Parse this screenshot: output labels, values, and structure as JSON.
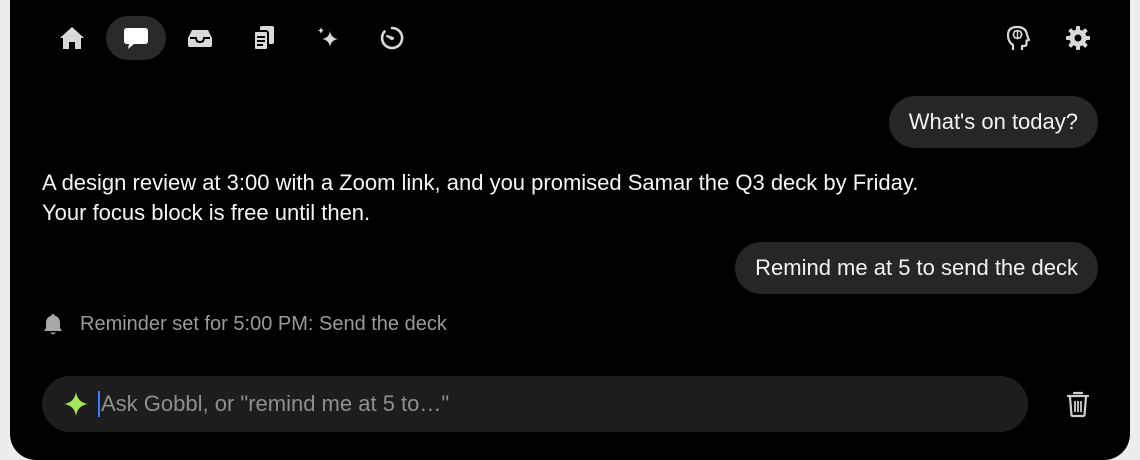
{
  "nav": {
    "tabs": [
      {
        "icon": "home-icon",
        "active": false
      },
      {
        "icon": "chat-bubble-icon",
        "active": true
      },
      {
        "icon": "inbox-icon",
        "active": false
      },
      {
        "icon": "documents-icon",
        "active": false
      },
      {
        "icon": "sparkles-icon",
        "active": false
      },
      {
        "icon": "timer-icon",
        "active": false
      }
    ],
    "right_icons": [
      "brain-head-icon",
      "gear-icon"
    ]
  },
  "conversation": {
    "user_message_1": "What's on today?",
    "assistant_message_1_line_1": "A design review at 3:00 with a Zoom link, and you promised Samar the Q3 deck by Friday.",
    "assistant_message_1_line_2": "Your focus block is free until then.",
    "user_message_2": "Remind me at 5 to send the deck",
    "reminder_status": "Reminder set for 5:00 PM: Send the deck"
  },
  "composer": {
    "placeholder": "Ask Gobbl, or \"remind me at 5 to…\"",
    "value": ""
  },
  "colors": {
    "background": "#000000",
    "bubble": "#262626",
    "input_bar": "#1d1d1d",
    "accent_sparkle": "#a6e85c",
    "muted_text": "#9a9a9a"
  }
}
